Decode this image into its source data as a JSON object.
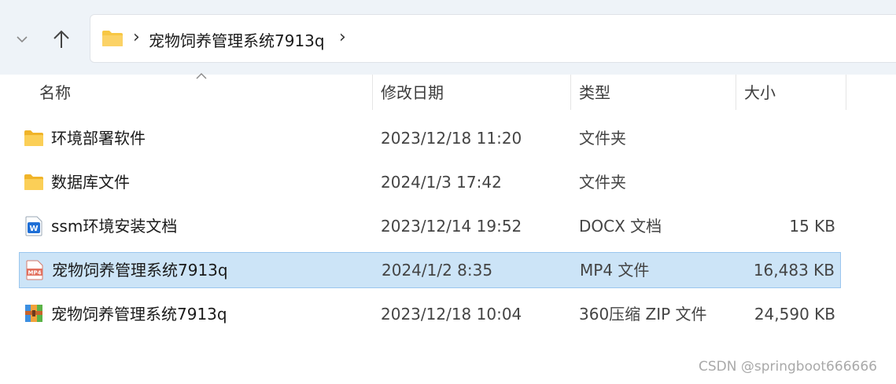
{
  "address_bar": {
    "crumb": "宠物饲养管理系统7913q",
    "separator": "›"
  },
  "columns": {
    "name": "名称",
    "date_modified": "修改日期",
    "type": "类型",
    "size": "大小"
  },
  "files": [
    {
      "name": "环境部署软件",
      "date": "2023/12/18 11:20",
      "type": "文件夹",
      "size": "",
      "icon": "folder-icon"
    },
    {
      "name": "数据库文件",
      "date": "2024/1/3 17:42",
      "type": "文件夹",
      "size": "",
      "icon": "folder-icon"
    },
    {
      "name": "ssm环境安装文档",
      "date": "2023/12/14 19:52",
      "type": "DOCX 文档",
      "size": "15 KB",
      "icon": "word-document-icon"
    },
    {
      "name": "宠物饲养管理系统7913q",
      "date": "2024/1/2 8:35",
      "type": "MP4 文件",
      "size": "16,483 KB",
      "icon": "mp4-video-icon",
      "selected": true
    },
    {
      "name": "宠物饲养管理系统7913q",
      "date": "2023/12/18 10:04",
      "type": "360压缩 ZIP 文件",
      "size": "24,590 KB",
      "icon": "zip-archive-icon"
    }
  ],
  "watermark": "CSDN @springboot666666",
  "colors": {
    "toolbar_bg": "#eef3f8",
    "selection_bg": "#cce4f7",
    "selection_border": "#9ac6ee",
    "folder_yellow": "#f7c744"
  }
}
